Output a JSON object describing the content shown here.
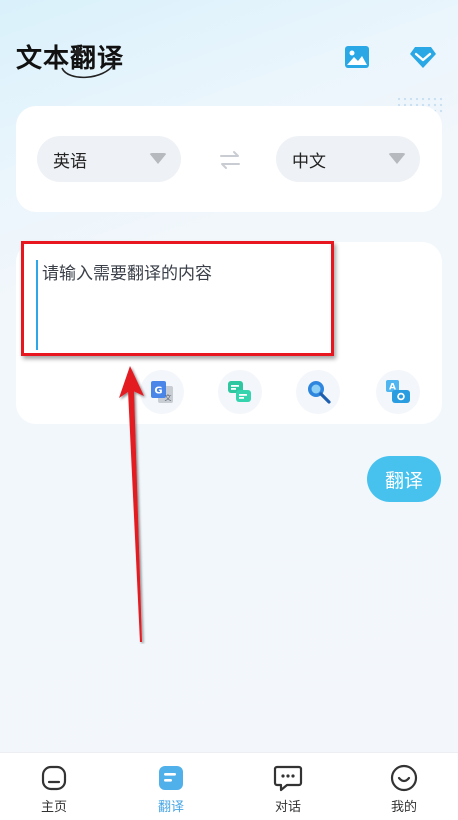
{
  "header": {
    "title": "文本翻译",
    "image_icon": "image-icon",
    "vip_icon": "diamond-icon"
  },
  "languages": {
    "source": "英语",
    "target": "中文",
    "swap_icon": "swap-arrows-icon"
  },
  "input": {
    "placeholder": "请输入需要翻译的内容",
    "value": ""
  },
  "tools": [
    {
      "icon": "google-translate-icon"
    },
    {
      "icon": "chat-translate-icon"
    },
    {
      "icon": "magnifier-icon"
    },
    {
      "icon": "camera-translate-icon"
    }
  ],
  "translate_button": "翻译",
  "tabbar": {
    "items": [
      {
        "label": "主页",
        "icon": "home-icon"
      },
      {
        "label": "翻译",
        "icon": "translate-doc-icon"
      },
      {
        "label": "对话",
        "icon": "chat-bubble-icon"
      },
      {
        "label": "我的",
        "icon": "smile-user-icon"
      }
    ],
    "active_index": 1
  },
  "colors": {
    "accent": "#47c2ef",
    "active_tab": "#47a6e6",
    "annotation_red": "#e8171f"
  }
}
